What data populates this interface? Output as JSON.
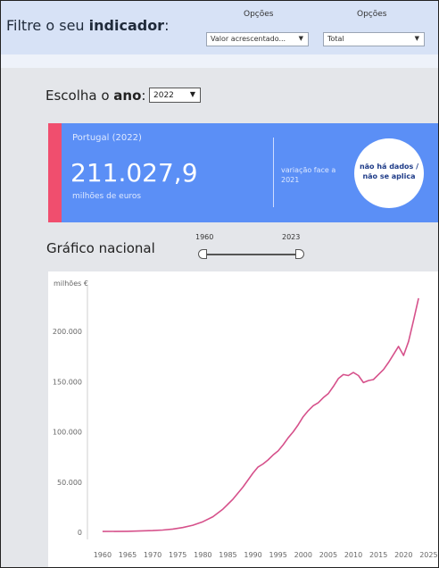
{
  "filter": {
    "title_prefix": "Filtre o seu ",
    "title_bold": "indicador",
    "title_suffix": ":",
    "options": [
      {
        "label": "Opções",
        "selected": "Valor acrescentado..."
      },
      {
        "label": "Opções",
        "selected": "Total"
      }
    ]
  },
  "year": {
    "label_prefix": "Escolha o ",
    "label_bold": "ano",
    "label_suffix": ":",
    "selected": "2022"
  },
  "kpi": {
    "subtitle": "Portugal (2022)",
    "value": "211.027,9",
    "unit": "milhões de euros",
    "variation_label": "variação face a 2021",
    "variation_value": "não há dados / não se aplica"
  },
  "range": {
    "start": "1960",
    "end": "2023"
  },
  "chart_data": {
    "type": "line",
    "title": "Gráfico nacional",
    "ylabel": "milhões €",
    "xlabel": "",
    "ylim": [
      0,
      240000
    ],
    "xlim": [
      1957,
      2026
    ],
    "y_ticks": [
      0,
      50000,
      100000,
      150000,
      200000
    ],
    "y_tick_labels": [
      "0",
      "50.000",
      "100.000",
      "150.000",
      "200.000"
    ],
    "x_ticks": [
      1960,
      1965,
      1970,
      1975,
      1980,
      1985,
      1990,
      1995,
      2000,
      2005,
      2010,
      2015,
      2020,
      2025
    ],
    "grid": false,
    "line_color": "#d6518b",
    "x": [
      1960,
      1965,
      1970,
      1972,
      1974,
      1976,
      1978,
      1980,
      1982,
      1984,
      1986,
      1988,
      1990,
      1991,
      1992,
      1993,
      1994,
      1995,
      1996,
      1997,
      1998,
      1999,
      2000,
      2001,
      2002,
      2003,
      2004,
      2005,
      2006,
      2007,
      2008,
      2009,
      2010,
      2011,
      2012,
      2013,
      2014,
      2015,
      2016,
      2017,
      2018,
      2019,
      2020,
      2021,
      2022,
      2023
    ],
    "values": [
      800,
      1000,
      1700,
      2200,
      3200,
      4700,
      7000,
      10500,
      15500,
      23000,
      33000,
      45000,
      59000,
      65000,
      68000,
      72000,
      77000,
      81000,
      87000,
      94000,
      100000,
      107000,
      115000,
      121000,
      126000,
      129000,
      134000,
      138000,
      145000,
      153000,
      157000,
      156000,
      159000,
      156000,
      149000,
      151000,
      152000,
      157000,
      162000,
      169000,
      177000,
      185000,
      176000,
      190000,
      211000,
      233000
    ]
  },
  "colors": {
    "filter_bg": "#d7e2f6",
    "page_bg": "#e4e6ea",
    "kpi_bg": "#5b8ff6",
    "kpi_accent": "#f04e6e",
    "line": "#d6518b"
  }
}
